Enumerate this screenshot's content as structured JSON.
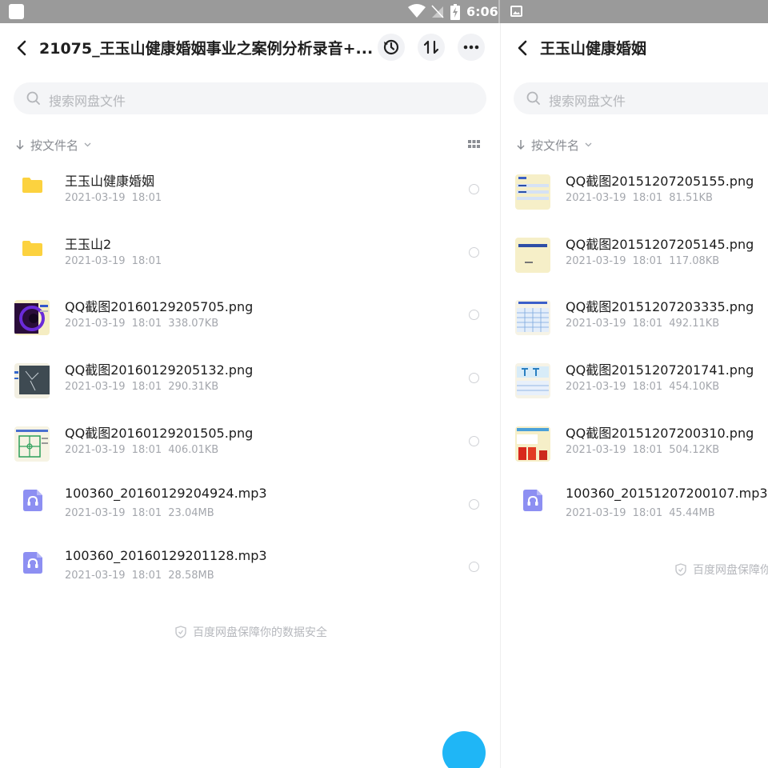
{
  "status_bar": {
    "time": "6:06"
  },
  "left": {
    "title": "21075_王玉山健康婚姻事业之案例分析录音+...",
    "search_placeholder": "搜索网盘文件",
    "sort_label": "按文件名",
    "files": [
      {
        "name": "王玉山健康婚姻",
        "meta": "2021-03-19 18:01",
        "type": "folder",
        "icon": "folder-icon"
      },
      {
        "name": "王玉山2",
        "meta": "2021-03-19 18:01",
        "type": "folder",
        "icon": "folder-icon"
      },
      {
        "name": "QQ截图20160129205705.png",
        "meta": "2021-03-19 18:01 338.07KB",
        "type": "image"
      },
      {
        "name": "QQ截图20160129205132.png",
        "meta": "2021-03-19 18:01 290.31KB",
        "type": "image"
      },
      {
        "name": "QQ截图20160129201505.png",
        "meta": "2021-03-19 18:01 406.01KB",
        "type": "image"
      },
      {
        "name": "100360_20160129204924.mp3",
        "meta": "2021-03-19 18:01 23.04MB",
        "type": "audio",
        "icon": "audio-file-icon"
      },
      {
        "name": "100360_20160129201128.mp3",
        "meta": "2021-03-19 18:01 28.58MB",
        "type": "audio",
        "icon": "audio-file-icon"
      }
    ],
    "footer": "百度网盘保障你的数据安全"
  },
  "right": {
    "title": "王玉山健康婚姻",
    "search_placeholder": "搜索网盘文件",
    "sort_label": "按文件名",
    "files": [
      {
        "name": "QQ截图20151207205155.png",
        "meta": "2021-03-19 18:01 81.51KB",
        "type": "image"
      },
      {
        "name": "QQ截图20151207205145.png",
        "meta": "2021-03-19 18:01 117.08KB",
        "type": "image"
      },
      {
        "name": "QQ截图20151207203335.png",
        "meta": "2021-03-19 18:01 492.11KB",
        "type": "image"
      },
      {
        "name": "QQ截图20151207201741.png",
        "meta": "2021-03-19 18:01 454.10KB",
        "type": "image"
      },
      {
        "name": "QQ截图20151207200310.png",
        "meta": "2021-03-19 18:01 504.12KB",
        "type": "image"
      },
      {
        "name": "100360_20151207200107.mp3",
        "meta": "2021-03-19 18:01 45.44MB",
        "type": "audio",
        "icon": "audio-file-icon"
      }
    ],
    "footer": "百度网盘保障你"
  },
  "colors": {
    "folder": "#fcd23f",
    "audio": "#8d8ff2",
    "fab": "#1fb6f6",
    "status_bar": "#9a9a9a"
  }
}
